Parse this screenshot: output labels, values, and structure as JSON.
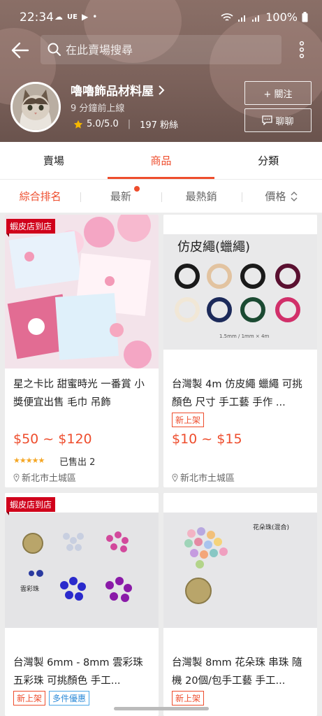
{
  "status_bar": {
    "time": "22:34",
    "left_icons": [
      "☁",
      "UE",
      "▶",
      "•"
    ],
    "battery": "100%"
  },
  "search": {
    "placeholder": "在此賣場搜尋"
  },
  "shop": {
    "name": "嚕嚕飾品材料屋",
    "last_online": "9 分鐘前上線",
    "rating": "5.0/5.0",
    "followers": "197 粉絲",
    "follow_label": "+ 關注",
    "chat_label": "聊聊"
  },
  "tabs": [
    "賣場",
    "商品",
    "分類"
  ],
  "active_tab": 1,
  "sort": [
    "綜合排名",
    "最新",
    "最熱銷",
    "價格"
  ],
  "products": [
    {
      "ribbon": "蝦皮店到店",
      "title": "星之卡比 甜蜜時光 一番賞 小獎便宜出售 毛巾 吊飾",
      "badges": [],
      "price": "$50 ~ $120",
      "sold": "已售出 2",
      "location": "新北市土城區"
    },
    {
      "ribbon": "",
      "title": "台灣製 4m 仿皮繩 蠟繩 可挑顏色 尺寸 手工藝 手作 ...",
      "badges": [
        "新上架"
      ],
      "price": "$10 ~ $15",
      "sold": "",
      "location": "新北市土城區"
    },
    {
      "ribbon": "蝦皮店到店",
      "title": "台灣製 6mm - 8mm 雲彩珠 五彩珠 可挑顏色 手工...",
      "badges": [
        "新上架",
        "多件優惠"
      ],
      "price": "",
      "sold": "",
      "location": ""
    },
    {
      "ribbon": "",
      "title": "台灣製 8mm 花朵珠 串珠 隨機 20個/包手工藝 手工...",
      "badges": [
        "新上架"
      ],
      "price": "",
      "sold": "",
      "location": ""
    }
  ],
  "image_text": {
    "cord_title": "仿皮繩(蠟繩)",
    "cord_spec": "1.5mm / 1mm × 4m",
    "bead_label": "雲彩珠",
    "flower_label": "花朵珠(混合)"
  },
  "colors": {
    "accent": "#ee4d2d",
    "header": "#7c625b"
  }
}
